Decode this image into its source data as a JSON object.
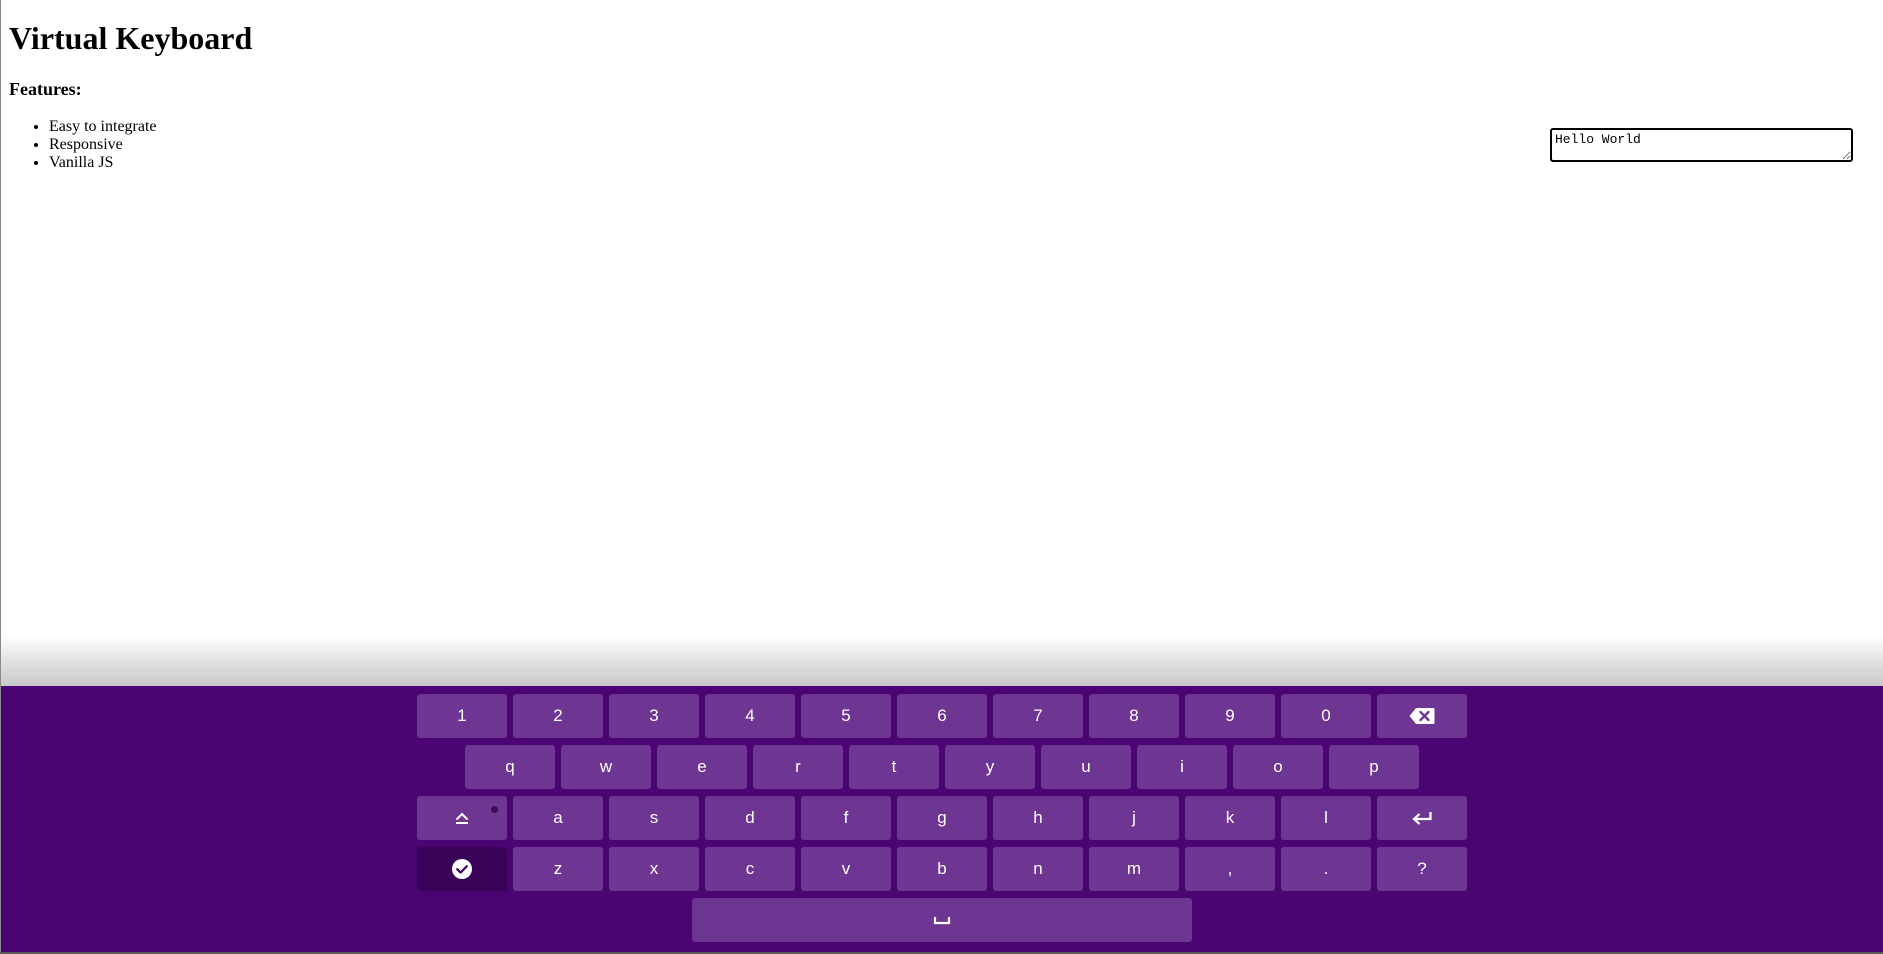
{
  "page": {
    "title": "Virtual Keyboard",
    "features_heading": "Features:",
    "features": [
      "Easy to integrate",
      "Responsive",
      "Vanilla JS"
    ]
  },
  "input": {
    "value": "Hello World"
  },
  "keyboard": {
    "background_color": "#4a0572",
    "key_color": "#6f3592",
    "active_key_color": "#3a0259",
    "row1": [
      "1",
      "2",
      "3",
      "4",
      "5",
      "6",
      "7",
      "8",
      "9",
      "0"
    ],
    "row2": [
      "q",
      "w",
      "e",
      "r",
      "t",
      "y",
      "u",
      "i",
      "o",
      "p"
    ],
    "row3": [
      "a",
      "s",
      "d",
      "f",
      "g",
      "h",
      "j",
      "k",
      "l"
    ],
    "row4": [
      "z",
      "x",
      "c",
      "v",
      "b",
      "n",
      "m",
      ",",
      ".",
      "?"
    ],
    "icons": {
      "backspace": "backspace-icon",
      "shift": "shift-icon",
      "enter": "enter-icon",
      "done": "check-circle-icon",
      "space": "space-icon"
    }
  }
}
